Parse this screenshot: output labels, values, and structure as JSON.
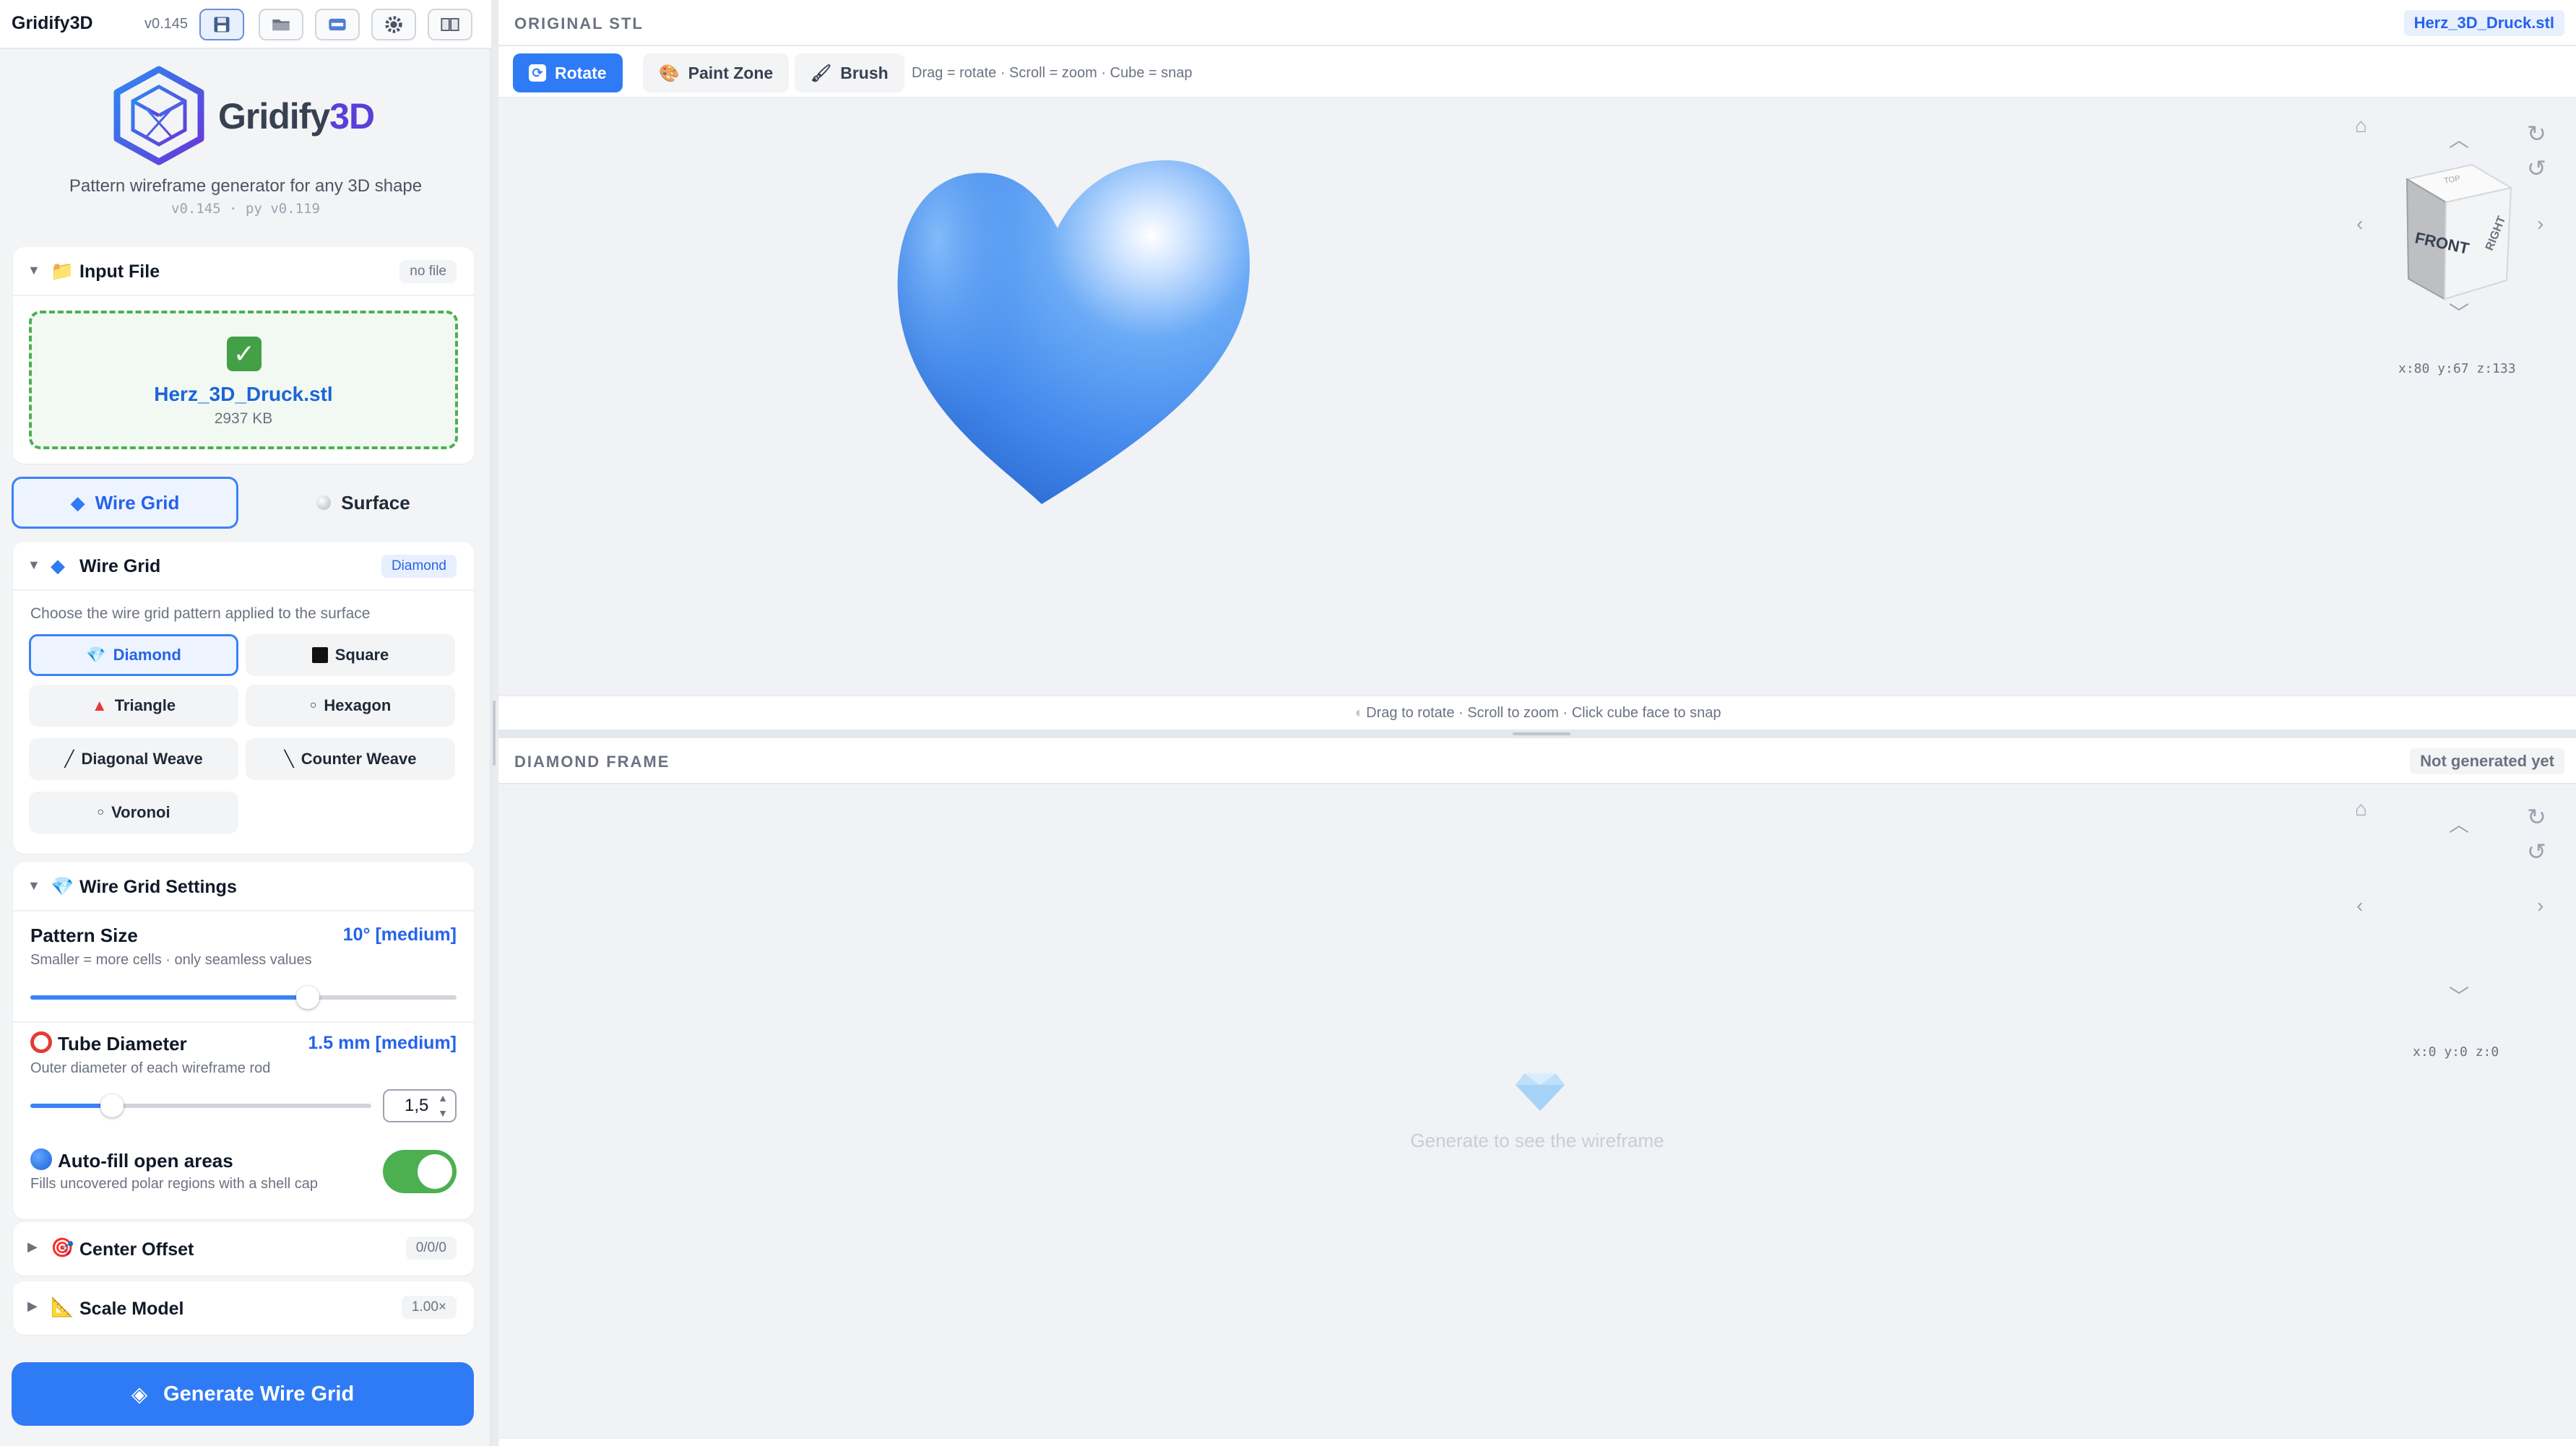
{
  "app": {
    "name": "Gridify3D",
    "version": "v0.145",
    "logo_text_main": "Gridify",
    "logo_text_accent": "3D",
    "tagline": "Pattern wireframe generator for any 3D shape",
    "versions_line": "v0.145 · py v0.119"
  },
  "toolbar": {
    "buttons": [
      {
        "name": "save",
        "icon": "floppy-disk-icon"
      },
      {
        "name": "open",
        "icon": "folder-icon"
      },
      {
        "name": "new",
        "icon": "new-icon"
      },
      {
        "name": "settings",
        "icon": "gear-icon"
      },
      {
        "name": "docs",
        "icon": "book-icon"
      }
    ]
  },
  "input_file": {
    "title": "Input File",
    "badge": "no file",
    "file_name": "Herz_3D_Druck.stl",
    "file_size": "2937 KB"
  },
  "mode": {
    "wire_label": "Wire Grid",
    "surface_label": "Surface",
    "selected": "Wire Grid"
  },
  "wire_grid": {
    "title": "Wire Grid",
    "badge": "Diamond",
    "hint": "Choose the wire grid pattern applied to the surface",
    "patterns": [
      "Diamond",
      "Square",
      "Triangle",
      "Hexagon",
      "Diagonal Weave",
      "Counter Weave",
      "Voronoi"
    ],
    "selected": "Diamond"
  },
  "settings": {
    "title": "Wire Grid Settings",
    "pattern_size": {
      "label": "Pattern Size",
      "value": "10° [medium]",
      "sub": "Smaller = more cells · only seamless values",
      "fraction": 0.65
    },
    "tube_diameter": {
      "label": "Tube Diameter",
      "value": "1.5 mm [medium]",
      "sub": "Outer diameter of each wireframe rod",
      "input": "1,5",
      "fraction": 0.24
    },
    "autofill": {
      "label": "Auto-fill open areas",
      "sub": "Fills uncovered polar regions with a shell cap",
      "on": true
    }
  },
  "center_offset": {
    "title": "Center Offset",
    "badge": "0/0/0"
  },
  "scale_model": {
    "title": "Scale Model",
    "badge": "1.00×"
  },
  "generate_label": "Generate Wire Grid",
  "original_panel": {
    "title": "ORIGINAL STL",
    "badge": "Herz_3D_Druck.stl",
    "tools": [
      "Rotate",
      "Paint Zone",
      "Brush"
    ],
    "active_tool": "Rotate",
    "help": "Drag = rotate · Scroll = zoom · Cube = snap",
    "coords": "x:80 y:67 z:133",
    "caption": "Drag to rotate · Scroll to zoom · Click cube face to snap",
    "cube_front": "FRONT",
    "cube_right": "RIGHT",
    "cube_top": "TOP"
  },
  "frame_panel": {
    "title": "DIAMOND FRAME",
    "badge": "Not generated yet",
    "coords": "x:0 y:0 z:0",
    "empty_text": "Generate to see the wireframe"
  },
  "colors": {
    "accent": "#2f7bf5",
    "success": "#4caf50",
    "heart": "#4b93f0",
    "brand_purple": "#5b3fd8"
  }
}
